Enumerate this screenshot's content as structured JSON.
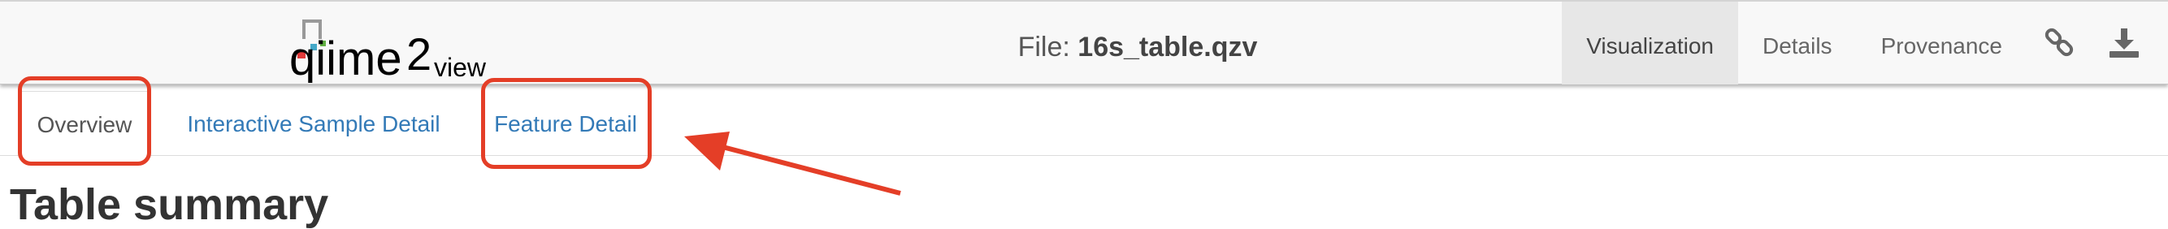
{
  "header": {
    "logo_main": "qiime",
    "logo_two": "2",
    "logo_suffix": "view",
    "file_label": "File:",
    "file_name": "16s_table.qzv",
    "nav": [
      {
        "label": "Visualization",
        "active": true
      },
      {
        "label": "Details",
        "active": false
      },
      {
        "label": "Provenance",
        "active": false
      }
    ],
    "icons": [
      "link-icon",
      "download-icon"
    ]
  },
  "tabs": [
    {
      "label": "Overview",
      "active": true
    },
    {
      "label": "Interactive Sample Detail",
      "active": false
    },
    {
      "label": "Feature Detail",
      "active": false
    }
  ],
  "content": {
    "heading_peek": "Table summary"
  },
  "annotation": {
    "color": "#e43e27"
  }
}
